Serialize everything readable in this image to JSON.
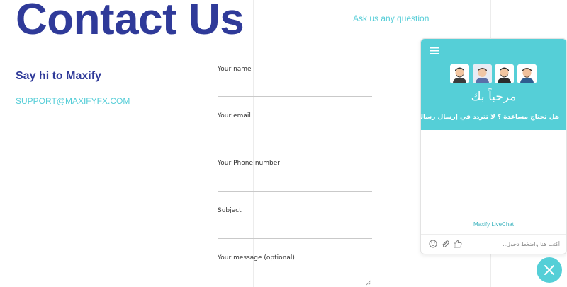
{
  "header": {
    "title": "Contact Us",
    "ask_link": "Ask us any question"
  },
  "contact": {
    "say_hi": "Say hi to Maxify",
    "email": "SUPPORT@MAXIFYFX.COM"
  },
  "form": {
    "fields": [
      {
        "label": "Your name"
      },
      {
        "label": "Your email"
      },
      {
        "label": "Your Phone number"
      },
      {
        "label": "Subject"
      },
      {
        "label": "Your message (optional)"
      }
    ]
  },
  "chat": {
    "greeting": "مرحباً بك",
    "subtext": "هل تحتاج مساعدة ؟ لا تتردد في إرسال رسالة الآن",
    "brand": "Maxify LiveChat",
    "input_placeholder": "أكتب هنا واضغط دخول..",
    "icons": [
      "menu-icon",
      "emoji-icon",
      "attachment-icon",
      "thumbs-up-icon",
      "close-icon"
    ],
    "accent_color": "#55cfd7"
  },
  "colors": {
    "title": "#2f3a99",
    "link": "#55cdd7"
  }
}
